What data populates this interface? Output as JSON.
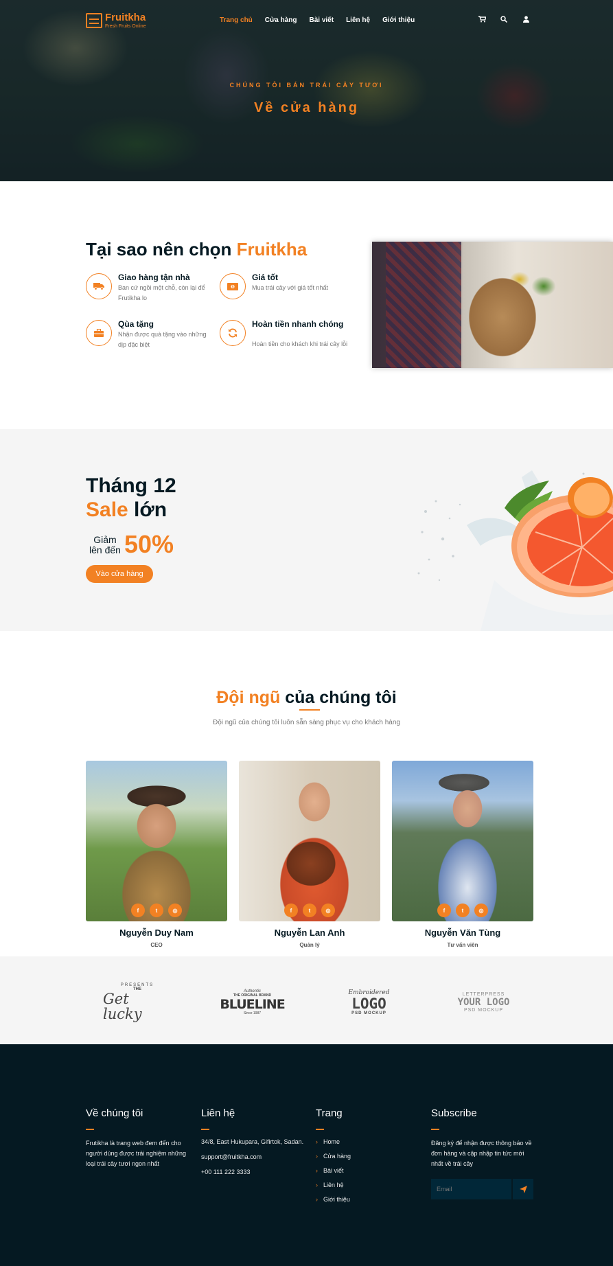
{
  "brand": {
    "name": "Fruitkha",
    "tagline": "Fresh Fruits Online"
  },
  "nav": {
    "items": [
      {
        "label": "Trang chủ",
        "active": true
      },
      {
        "label": "Cửa hàng"
      },
      {
        "label": "Bài viết"
      },
      {
        "label": "Liên hệ"
      },
      {
        "label": "Giới thiệu"
      }
    ],
    "icons": [
      "cart-icon",
      "search-icon",
      "user-icon"
    ]
  },
  "hero": {
    "subtitle": "CHÚNG TÔI BÁN TRÁI CÂY TƯƠI",
    "title": "Về cửa hàng"
  },
  "why": {
    "title_prefix": "Tại sao nên chọn ",
    "title_accent": "Fruitkha",
    "features": [
      {
        "icon": "truck-icon",
        "title": "Giao hàng tận nhà",
        "desc": "Ban cứ ngồi một chỗ, còn lại để Frutikha lo"
      },
      {
        "icon": "money-icon",
        "title": "Giá tốt",
        "desc": "Mua trái cây với giá tốt nhất"
      },
      {
        "icon": "gift-icon",
        "title": "Qùa tặng",
        "desc": "Nhận được quà tặng vào những dịp đặc biệt"
      },
      {
        "icon": "refresh-icon",
        "title": "Hoàn tiền nhanh chóng",
        "desc": "Hoàn tiền cho khách khi trái cây lỗi"
      }
    ]
  },
  "sale": {
    "line1": "Tháng 12",
    "line2_accent": "Sale",
    "line2_rest": " lớn",
    "off_label_1": "Giảm",
    "off_label_2": "lên đến",
    "percent": "50%",
    "button": "Vào cửa hàng"
  },
  "team": {
    "title_accent": "Đội ngũ",
    "title_rest": " của chúng tôi",
    "subtitle": "Đội ngũ của chúng tôi luôn sẵn sàng phục vụ cho khách hàng",
    "members": [
      {
        "name": "Nguyễn Duy Nam",
        "role": "CEO"
      },
      {
        "name": "Nguyễn Lan Anh",
        "role": "Quản lý"
      },
      {
        "name": "Nguyễn Văn Tùng",
        "role": "Tư vấn viên"
      }
    ]
  },
  "logos": [
    {
      "top": "PRESENTS",
      "main": "Get lucky",
      "sub": "THE",
      "small": ""
    },
    {
      "top": "Authentic",
      "main": "BLUELINE",
      "sub": "THE ORIGINAL BRAND",
      "small": "Since 1987"
    },
    {
      "top": "Embroidered",
      "main": "LOGO",
      "sub": "PSD MOCKUP",
      "small": ""
    },
    {
      "top": "LETTERPRESS",
      "main": "YOUR LOGO",
      "sub": "PSD MOCKUP",
      "small": ""
    }
  ],
  "footer": {
    "about": {
      "title": "Về chúng tôi",
      "text": "Frutikha là trang web đem đến cho người dùng được trải nghiệm những loại trái cây tươi ngon nhất"
    },
    "contact": {
      "title": "Liên hệ",
      "lines": [
        "34/8, East Hukupara, Gifirtok, Sadan.",
        "support@fruitkha.com",
        "+00 111 222 3333"
      ]
    },
    "pages": {
      "title": "Trang",
      "links": [
        "Home",
        "Cửa hàng",
        "Bài viết",
        "Liên hệ",
        "Giới thiệu"
      ]
    },
    "subscribe": {
      "title": "Subscribe",
      "text": "Đăng ký để nhận được thông báo về đơn hàng và cập nhập tin tức mới nhất về trái cây",
      "placeholder": "Email"
    }
  },
  "colors": {
    "accent": "#f28123",
    "dark": "#051922",
    "light_bg": "#f5f5f5"
  }
}
